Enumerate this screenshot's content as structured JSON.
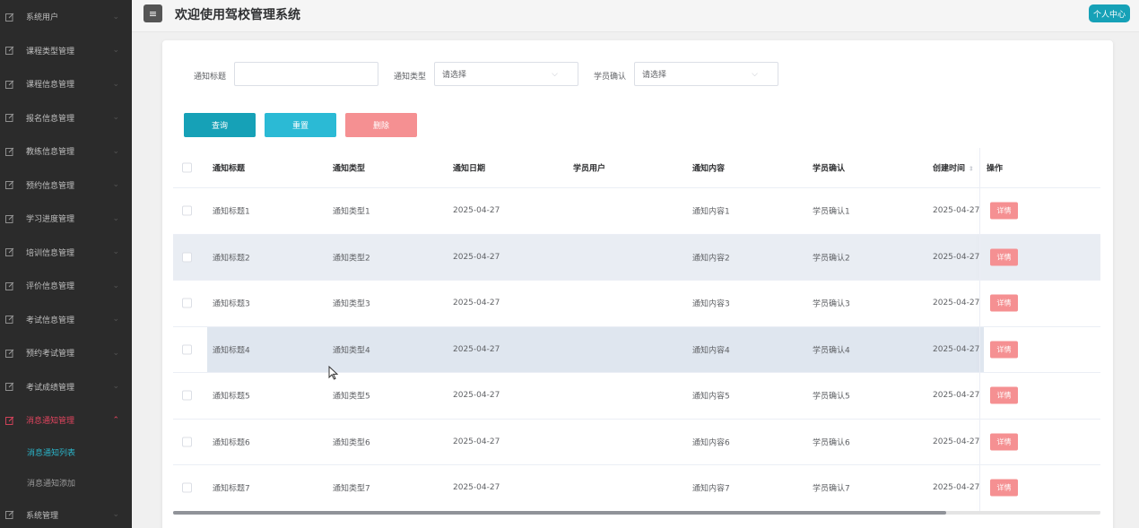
{
  "sidebar": {
    "items": [
      {
        "label": "系统用户",
        "icon": "edit-icon"
      },
      {
        "label": "课程类型管理",
        "icon": "edit-icon"
      },
      {
        "label": "课程信息管理",
        "icon": "edit-icon"
      },
      {
        "label": "报名信息管理",
        "icon": "edit-icon"
      },
      {
        "label": "教练信息管理",
        "icon": "edit-icon"
      },
      {
        "label": "预约信息管理",
        "icon": "edit-icon"
      },
      {
        "label": "学习进度管理",
        "icon": "edit-icon"
      },
      {
        "label": "培训信息管理",
        "icon": "edit-icon"
      },
      {
        "label": "评价信息管理",
        "icon": "edit-icon"
      },
      {
        "label": "考试信息管理",
        "icon": "edit-icon"
      },
      {
        "label": "预约考试管理",
        "icon": "edit-icon"
      },
      {
        "label": "考试成绩管理",
        "icon": "edit-icon"
      },
      {
        "label": "消息通知管理",
        "icon": "edit-icon",
        "active": true
      }
    ],
    "submenu": [
      {
        "label": "消息通知列表",
        "active": true
      },
      {
        "label": "消息通知添加"
      }
    ],
    "last_item": {
      "label": "系统管理",
      "icon": "edit-icon"
    }
  },
  "header": {
    "title": "欢迎使用驾校管理系统",
    "personal_center": "个人中心",
    "menu_icon": "hamburger-icon"
  },
  "filters": {
    "title_label": "通知标题",
    "title_value": "",
    "type_label": "通知类型",
    "type_value": "请选择",
    "confirm_label": "学员确认",
    "confirm_value": "请选择"
  },
  "buttons": {
    "query": "查询",
    "reset": "重置",
    "delete": "删除"
  },
  "table": {
    "columns": [
      "通知标题",
      "通知类型",
      "通知日期",
      "学员用户",
      "通知内容",
      "学员确认",
      "创建时间",
      "操作"
    ],
    "detail_label": "详情",
    "rows": [
      {
        "title": "通知标题1",
        "type": "通知类型1",
        "date": "2025-04-27",
        "user": "",
        "content": "通知内容1",
        "confirm": "学员确认1",
        "created": "2025-04-27"
      },
      {
        "title": "通知标题2",
        "type": "通知类型2",
        "date": "2025-04-27",
        "user": "",
        "content": "通知内容2",
        "confirm": "学员确认2",
        "created": "2025-04-27"
      },
      {
        "title": "通知标题3",
        "type": "通知类型3",
        "date": "2025-04-27",
        "user": "",
        "content": "通知内容3",
        "confirm": "学员确认3",
        "created": "2025-04-27"
      },
      {
        "title": "通知标题4",
        "type": "通知类型4",
        "date": "2025-04-27",
        "user": "",
        "content": "通知内容4",
        "confirm": "学员确认4",
        "created": "2025-04-27"
      },
      {
        "title": "通知标题5",
        "type": "通知类型5",
        "date": "2025-04-27",
        "user": "",
        "content": "通知内容5",
        "confirm": "学员确认5",
        "created": "2025-04-27"
      },
      {
        "title": "通知标题6",
        "type": "通知类型6",
        "date": "2025-04-27",
        "user": "",
        "content": "通知内容6",
        "confirm": "学员确认6",
        "created": "2025-04-27"
      },
      {
        "title": "通知标题7",
        "type": "通知类型7",
        "date": "2025-04-27",
        "user": "",
        "content": "通知内容7",
        "confirm": "学员确认7",
        "created": "2025-04-27"
      }
    ]
  },
  "colors": {
    "primary": "#16a1b7",
    "reset": "#2bbad5",
    "danger": "#f59092",
    "sidebar_bg": "#2b2b2b",
    "active_menu": "#e0445e",
    "active_submenu": "#2bb4c9"
  }
}
